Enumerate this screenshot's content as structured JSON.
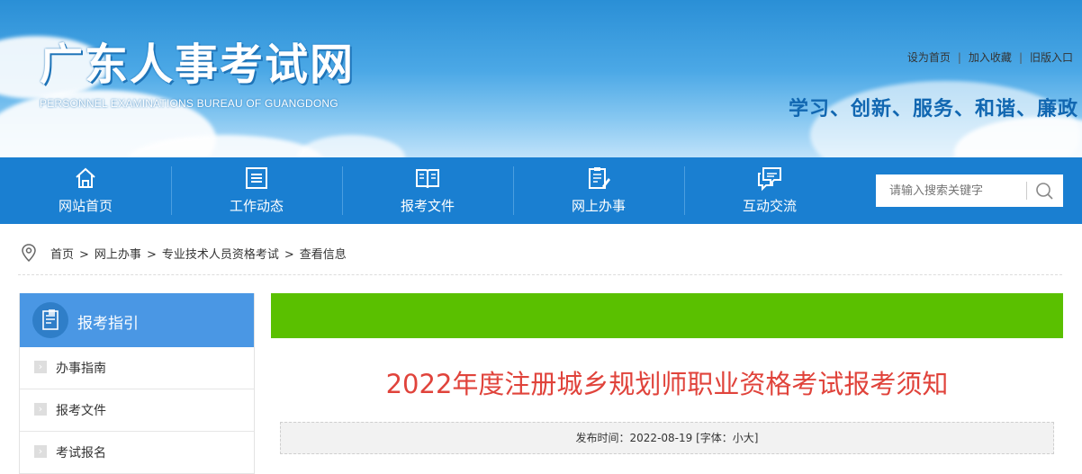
{
  "header": {
    "title": "广东人事考试网",
    "subtitle": "PERSONNEL EXAMINATIONS BUREAU OF GUANGDONG",
    "top_links": [
      "设为首页",
      "加入收藏",
      "旧版入口"
    ],
    "slogan": "学习、创新、服务、和谐、廉政"
  },
  "nav": {
    "items": [
      {
        "label": "网站首页",
        "icon": "home-icon"
      },
      {
        "label": "工作动态",
        "icon": "news-icon"
      },
      {
        "label": "报考文件",
        "icon": "book-icon"
      },
      {
        "label": "网上办事",
        "icon": "clipboard-edit-icon"
      },
      {
        "label": "互动交流",
        "icon": "chat-icon"
      }
    ],
    "search_placeholder": "请输入搜索关键字"
  },
  "breadcrumb": [
    "首页",
    "网上办事",
    "专业技术人员资格考试",
    "查看信息"
  ],
  "sidebar": {
    "title": "报考指引",
    "items": [
      "办事指南",
      "报考文件",
      "考试报名"
    ]
  },
  "article": {
    "title": "2022年度注册城乡规划师职业资格考试报考须知",
    "meta": "发布时间：2022-08-19  [字体：小大]"
  },
  "colors": {
    "nav": "#1a7fd1",
    "sidebar_head": "#4a97e4",
    "green_bar": "#5ac000",
    "title_red": "#e0433b",
    "slogan_blue": "#1167b1"
  }
}
